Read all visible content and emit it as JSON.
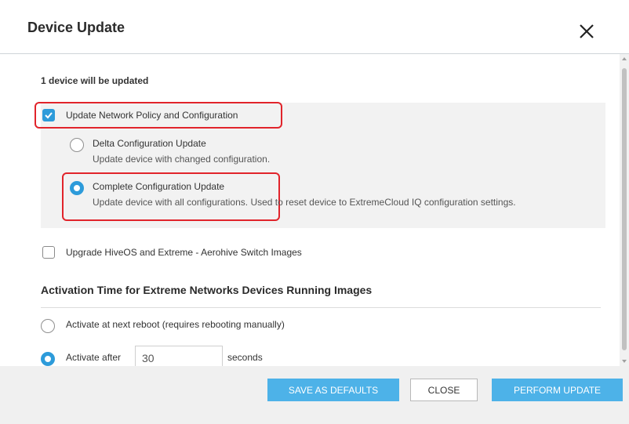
{
  "dialog": {
    "title": "Device Update"
  },
  "content": {
    "devices_count": "1 device will be updated",
    "update_policy": {
      "label": "Update Network Policy and Configuration",
      "checked": true
    },
    "delta_update": {
      "label": "Delta Configuration Update",
      "description": "Update device with changed configuration.",
      "selected": false
    },
    "complete_update": {
      "label": "Complete Configuration Update",
      "description": "Update device with all configurations. Used to reset device to ExtremeCloud IQ configuration settings.",
      "selected": true
    },
    "upgrade_images": {
      "label": "Upgrade HiveOS and Extreme - Aerohive Switch Images",
      "checked": false
    },
    "activation": {
      "title": "Activation Time for Extreme Networks Devices Running Images",
      "next_reboot_label": "Activate at next reboot (requires rebooting manually)",
      "next_reboot_selected": false,
      "after_label": "Activate after",
      "after_selected": true,
      "after_value": "30",
      "after_unit": "seconds"
    }
  },
  "footer": {
    "save_defaults_label": "SAVE AS DEFAULTS",
    "close_label": "CLOSE",
    "perform_label": "PERFORM UPDATE"
  },
  "colors": {
    "accent": "#2d9bda",
    "button_primary": "#4db2e8",
    "highlight": "#e1242b",
    "panel_bg": "#f2f2f2"
  }
}
